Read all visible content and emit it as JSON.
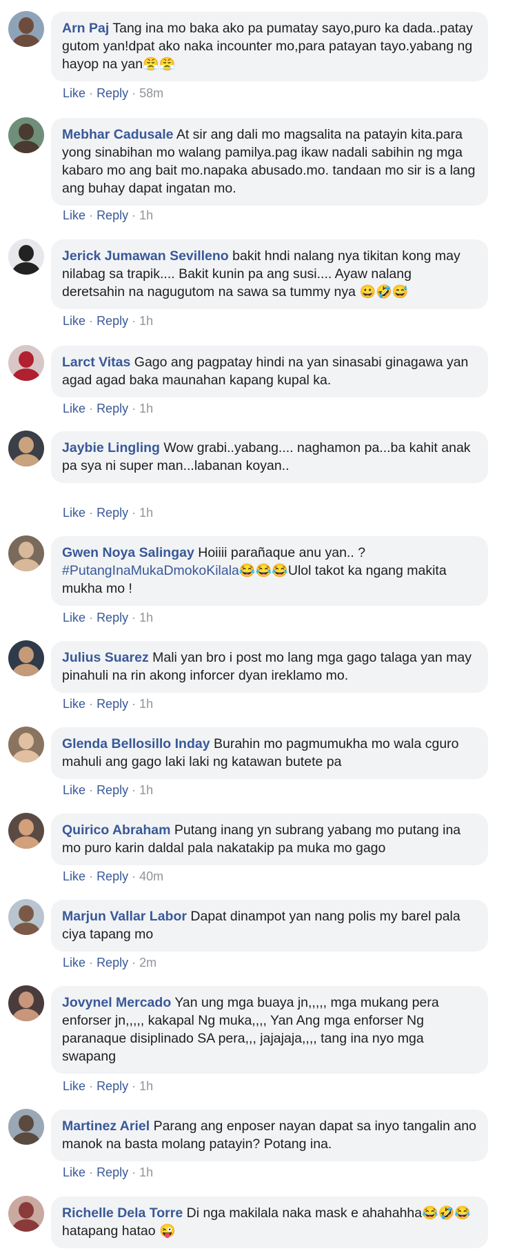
{
  "actions": {
    "like": "Like",
    "reply": "Reply",
    "sep": "·"
  },
  "comments": [
    {
      "author": "Arn Paj",
      "text": "Tang ina mo baka ako pa pumatay sayo,puro ka dada..patay gutom yan!dpat ako naka incounter mo,para patayan tayo.yabang ng hayop na yan",
      "emoji": "😤😤",
      "time": "58m",
      "avatar_bg": "#8fa3b8",
      "avatar_fg": "#6d4c3d"
    },
    {
      "author": "Mebhar Cadusale",
      "text": "At sir ang dali mo magsalita na patayin kita.para yong sinabihan mo walang pamilya.pag ikaw nadali sabihin ng mga kabaro mo ang bait mo.napaka abusado.mo. tandaan mo sir is a lang ang buhay dapat ingatan mo.",
      "emoji": "",
      "time": "1h",
      "avatar_bg": "#6f8f7a",
      "avatar_fg": "#4a3a30"
    },
    {
      "author": "Jerick Jumawan Sevilleno",
      "text": "bakit hndi nalang nya tikitan kong may nilabag sa trapik.... Bakit kunin pa ang susi.... Ayaw nalang deretsahin na nagugutom na sawa sa tummy nya",
      "emoji": "😀🤣😅",
      "time": "1h",
      "avatar_bg": "#e8e8ec",
      "avatar_fg": "#222222"
    },
    {
      "author": "Larct Vitas",
      "text": "Gago ang pagpatay hindi na yan sinasabi ginagawa yan agad agad baka maunahan kapang kupal ka.",
      "emoji": "",
      "time": "1h",
      "avatar_bg": "#d9c7c7",
      "avatar_fg": "#b02030"
    },
    {
      "author": "Jaybie Lingling",
      "text": "Wow grabi..yabang.... naghamon pa...ba kahit anak pa sya ni super man...labanan koyan..",
      "emoji": "",
      "time": "1h",
      "avatar_bg": "#3a3f48",
      "avatar_fg": "#c9a27e"
    },
    {
      "author": "Gwen Noya Salingay",
      "text": "Hoiiii parañaque anu yan.. ?",
      "hashtag": "#PutangInaMukaDmokoKilala",
      "emoji": "😂😂😂",
      "text2": "Ulol takot ka ngang makita mukha mo !",
      "time": "1h",
      "avatar_bg": "#7a6a5c",
      "avatar_fg": "#d8b89a"
    },
    {
      "author": "Julius Suarez",
      "text": "Mali yan bro i post mo lang mga gago talaga yan may pinahuli na rin akong inforcer dyan ireklamo mo.",
      "emoji": "",
      "time": "1h",
      "avatar_bg": "#2f3a4a",
      "avatar_fg": "#c49a78"
    },
    {
      "author": "Glenda Bellosillo Inday",
      "text": "Burahin mo pagmumukha mo wala cguro mahuli ang gago laki laki ng katawan butete pa",
      "emoji": "",
      "time": "1h",
      "avatar_bg": "#8a7460",
      "avatar_fg": "#e0c0a0"
    },
    {
      "author": "Quirico Abraham",
      "text": "Putang inang yn subrang yabang mo putang ina mo puro karin daldal pala nakatakip pa muka mo gago",
      "emoji": "",
      "time": "40m",
      "avatar_bg": "#5a4a44",
      "avatar_fg": "#d2a07a"
    },
    {
      "author": "Marjun Vallar Labor",
      "text": "Dapat dinampot yan nang polis my barel pala ciya tapang mo",
      "emoji": "",
      "time": "2m",
      "avatar_bg": "#b8c4cf",
      "avatar_fg": "#7a5a46"
    },
    {
      "author": "Jovynel Mercado",
      "text": "Yan ung mga buaya jn,,,,, mga mukang pera enforser jn,,,,, kakapal Ng muka,,,, Yan Ang mga enforser Ng paranaque disiplinado SA pera,,, jajajaja,,,, tang ina nyo mga swapang",
      "emoji": "",
      "time": "1h",
      "avatar_bg": "#4a3c3c",
      "avatar_fg": "#c8967a"
    },
    {
      "author": "Martinez Ariel",
      "text": "Parang ang enposer nayan dapat sa inyo tangalin ano manok na basta molang patayin? Potang ina.",
      "emoji": "",
      "time": "1h",
      "avatar_bg": "#9aa7b4",
      "avatar_fg": "#5a4a40"
    },
    {
      "author": "Richelle Dela Torre",
      "text": "Di nga makilala naka mask e ahahahha",
      "emoji": "😂🤣😂",
      "text2": "hatapang hatao",
      "emoji2": "😜",
      "time": "",
      "avatar_bg": "#c9a9a0",
      "avatar_fg": "#8a3a3a"
    }
  ]
}
